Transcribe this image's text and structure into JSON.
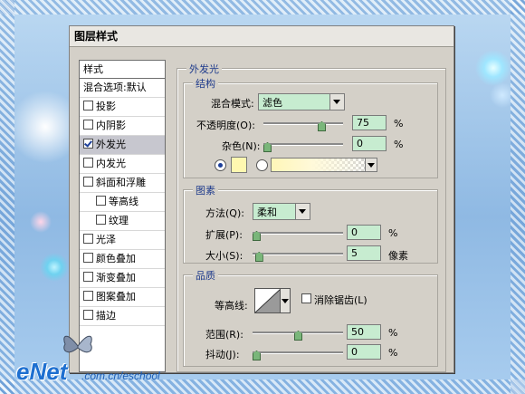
{
  "dialog": {
    "title": "图层样式"
  },
  "left_panel": {
    "header": "样式",
    "items": [
      {
        "label": "混合选项:默认",
        "checkbox": false,
        "checked": false,
        "sub": false,
        "selected": false
      },
      {
        "label": "投影",
        "checkbox": true,
        "checked": false,
        "sub": false,
        "selected": false
      },
      {
        "label": "内阴影",
        "checkbox": true,
        "checked": false,
        "sub": false,
        "selected": false
      },
      {
        "label": "外发光",
        "checkbox": true,
        "checked": true,
        "sub": false,
        "selected": true
      },
      {
        "label": "内发光",
        "checkbox": true,
        "checked": false,
        "sub": false,
        "selected": false
      },
      {
        "label": "斜面和浮雕",
        "checkbox": true,
        "checked": false,
        "sub": false,
        "selected": false
      },
      {
        "label": "等高线",
        "checkbox": true,
        "checked": false,
        "sub": true,
        "selected": false
      },
      {
        "label": "纹理",
        "checkbox": true,
        "checked": false,
        "sub": true,
        "selected": false
      },
      {
        "label": "光泽",
        "checkbox": true,
        "checked": false,
        "sub": false,
        "selected": false
      },
      {
        "label": "颜色叠加",
        "checkbox": true,
        "checked": false,
        "sub": false,
        "selected": false
      },
      {
        "label": "渐变叠加",
        "checkbox": true,
        "checked": false,
        "sub": false,
        "selected": false
      },
      {
        "label": "图案叠加",
        "checkbox": true,
        "checked": false,
        "sub": false,
        "selected": false
      },
      {
        "label": "描边",
        "checkbox": true,
        "checked": false,
        "sub": false,
        "selected": false
      }
    ]
  },
  "outer_glow": {
    "title": "外发光",
    "structure": {
      "title": "结构",
      "blend_mode_label": "混合模式:",
      "blend_mode_value": "滤色",
      "opacity_label": "不透明度(O):",
      "opacity_value": "75",
      "opacity_unit": "%",
      "opacity_level": 0.75,
      "noise_label": "杂色(N):",
      "noise_value": "0",
      "noise_unit": "%",
      "noise_level": 0,
      "color_swatch": "#fff8b0",
      "selected_fill": "color"
    },
    "elements": {
      "title": "图素",
      "technique_label": "方法(Q):",
      "technique_value": "柔和",
      "spread_label": "扩展(P):",
      "spread_value": "0",
      "spread_unit": "%",
      "spread_level": 0,
      "size_label": "大小(S):",
      "size_value": "5",
      "size_unit": "像素",
      "size_level": 0.03
    },
    "quality": {
      "title": "品质",
      "contour_label": "等高线:",
      "antialias_label": "消除锯齿(L)",
      "antialias_checked": false,
      "range_label": "范围(R):",
      "range_value": "50",
      "range_unit": "%",
      "range_level": 0.5,
      "jitter_label": "抖动(J):",
      "jitter_value": "0",
      "jitter_unit": "%",
      "jitter_level": 0
    }
  },
  "watermark": {
    "logo": "eNet",
    "url": ".com.cn/eschool"
  }
}
